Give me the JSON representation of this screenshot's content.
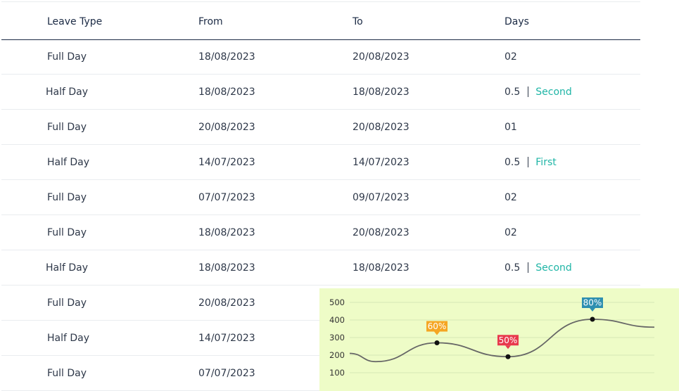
{
  "table": {
    "headers": {
      "type": "Leave Type",
      "from": "From",
      "to": "To",
      "days": "Days"
    },
    "rows": [
      {
        "type": "Full Day",
        "from": "18/08/2023",
        "to": "20/08/2023",
        "days": "02",
        "half": ""
      },
      {
        "type": "Half Day",
        "from": "18/08/2023",
        "to": "18/08/2023",
        "days": "0.5",
        "half": "Second"
      },
      {
        "type": "Full Day",
        "from": "20/08/2023",
        "to": "20/08/2023",
        "days": "01",
        "half": ""
      },
      {
        "type": "Half Day",
        "from": "14/07/2023",
        "to": "14/07/2023",
        "days": "0.5",
        "half": "First"
      },
      {
        "type": "Full Day",
        "from": "07/07/2023",
        "to": "09/07/2023",
        "days": "02",
        "half": ""
      },
      {
        "type": "Full Day",
        "from": "18/08/2023",
        "to": "20/08/2023",
        "days": "02",
        "half": ""
      },
      {
        "type": "Half Day",
        "from": "18/08/2023",
        "to": "18/08/2023",
        "days": "0.5",
        "half": "Second"
      },
      {
        "type": "Full Day",
        "from": "20/08/2023",
        "to": "",
        "days": "",
        "half": ""
      },
      {
        "type": "Half Day",
        "from": "14/07/2023",
        "to": "",
        "days": "",
        "half": ""
      },
      {
        "type": "Full Day",
        "from": "07/07/2023",
        "to": "",
        "days": "",
        "half": ""
      }
    ]
  },
  "chart_data": {
    "type": "line",
    "yticks": [
      500,
      400,
      300,
      200,
      100
    ],
    "ylim": [
      50,
      520
    ],
    "grid": true,
    "points": [
      {
        "x": 0,
        "y": 210
      },
      {
        "x": 1,
        "y": 163
      },
      {
        "x": 2,
        "y": 270,
        "label": "60%",
        "color": "#f5a623"
      },
      {
        "x": 3,
        "y": 191,
        "label": "50%",
        "color": "#e8394d"
      },
      {
        "x": 4,
        "y": 404,
        "label": "80%",
        "color": "#2e8fb0"
      },
      {
        "x": 5,
        "y": 359
      }
    ]
  },
  "colors": {
    "accent": "#1fb5a6",
    "header": "#1b2a44",
    "chart_bg": "#eefcc7"
  }
}
